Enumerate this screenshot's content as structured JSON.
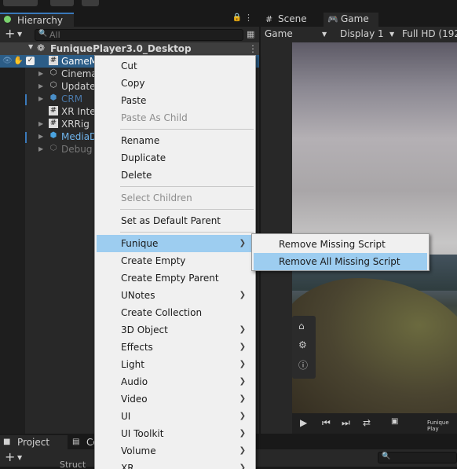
{
  "hierarchy": {
    "tab_label": "Hierarchy",
    "search_placeholder": "All",
    "scene_name": "FuniquePlayer3.0_Desktop",
    "items": [
      {
        "label": "GameM",
        "icon": "hash-script-icon",
        "selected": true
      },
      {
        "label": "Cinema",
        "icon": "gameobject-cube-icon"
      },
      {
        "label": "Update",
        "icon": "gameobject-cube-icon"
      },
      {
        "label": "CRM",
        "icon": "prefab-cube-icon"
      },
      {
        "label": "XR Inte",
        "icon": "hash-script-icon"
      },
      {
        "label": "XRRig",
        "icon": "hash-script-icon"
      },
      {
        "label": "MediaD",
        "icon": "prefab-cube-icon"
      },
      {
        "label": "Debug",
        "icon": "gameobject-cube-icon"
      }
    ]
  },
  "game_panel": {
    "tab_scene": "Scene",
    "tab_game": "Game",
    "game_dropdown": "Game",
    "display_dropdown": "Display 1",
    "resolution_dropdown": "Full HD (192",
    "player_caption": "Funique Play"
  },
  "project_panel": {
    "tab_project": "Project",
    "tab_console": "Co",
    "folder_partial": "Struct"
  },
  "context_menu": {
    "items": [
      {
        "label": "Cut"
      },
      {
        "label": "Copy"
      },
      {
        "label": "Paste"
      },
      {
        "label": "Paste As Child",
        "disabled": true
      },
      {
        "label": "Rename"
      },
      {
        "label": "Duplicate"
      },
      {
        "label": "Delete"
      },
      {
        "label": "Select Children",
        "disabled": true
      },
      {
        "label": "Set as Default Parent"
      },
      {
        "label": "Funique",
        "submenu": true,
        "highlighted": true
      },
      {
        "label": "Create Empty"
      },
      {
        "label": "Create Empty Parent"
      },
      {
        "label": "UNotes",
        "submenu": true
      },
      {
        "label": "Create Collection"
      },
      {
        "label": "3D Object",
        "submenu": true
      },
      {
        "label": "Effects",
        "submenu": true
      },
      {
        "label": "Light",
        "submenu": true
      },
      {
        "label": "Audio",
        "submenu": true
      },
      {
        "label": "Video",
        "submenu": true
      },
      {
        "label": "UI",
        "submenu": true
      },
      {
        "label": "UI Toolkit",
        "submenu": true
      },
      {
        "label": "Volume",
        "submenu": true
      },
      {
        "label": "XR",
        "submenu": true
      }
    ]
  },
  "funique_submenu": {
    "items": [
      {
        "label": "Remove Missing Script"
      },
      {
        "label": "Remove All Missing Script",
        "highlighted": true
      }
    ]
  },
  "colors": {
    "selection_blue": "#2c5d87",
    "menu_highlight": "#9dcdf0",
    "menu_background": "#f0f0f0"
  }
}
